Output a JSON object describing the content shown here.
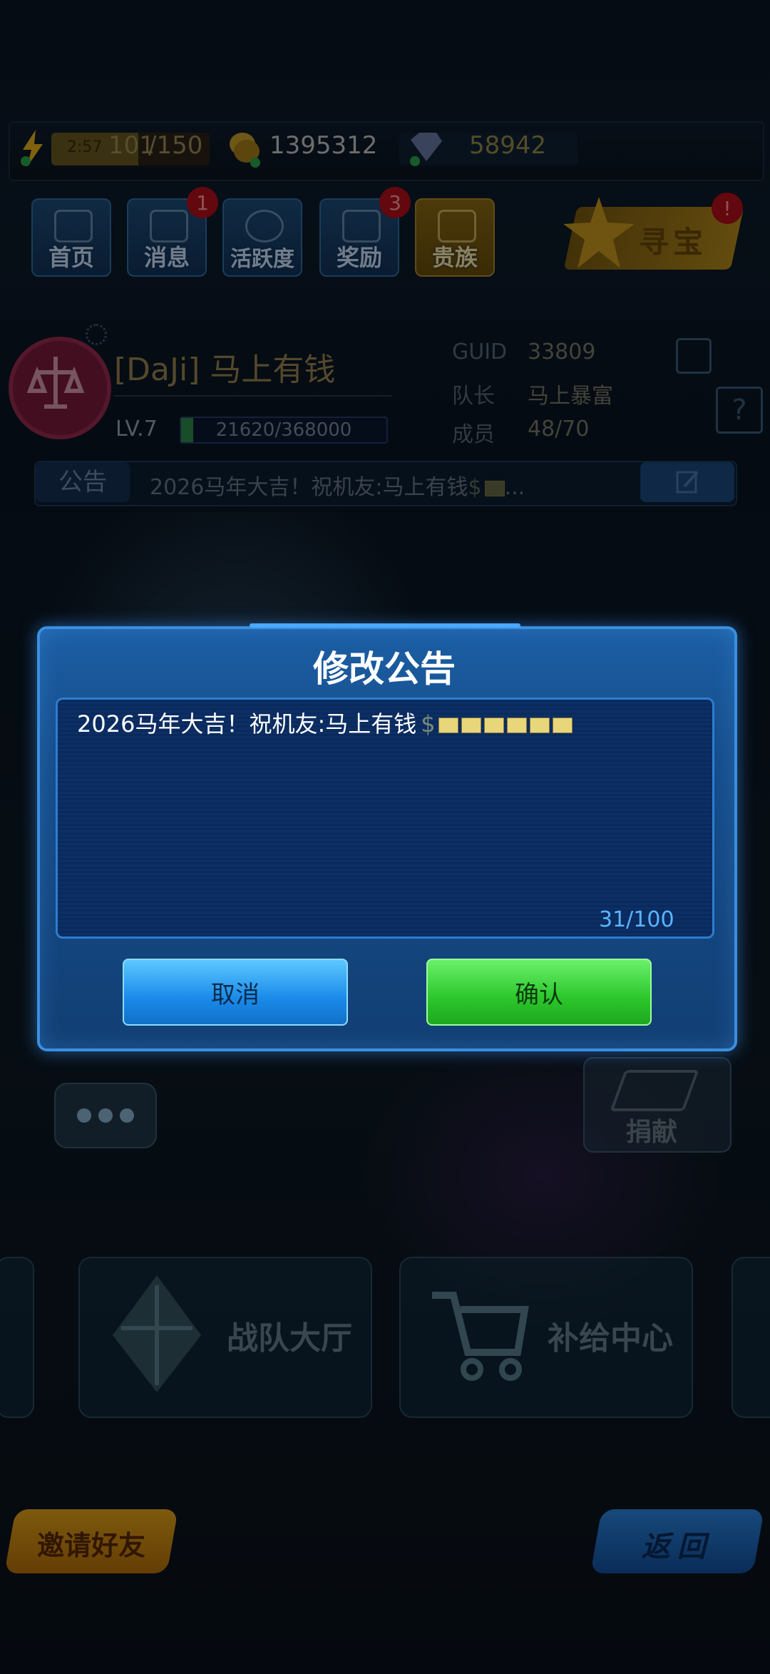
{
  "status_bar": {
    "energy_timer": "2:57",
    "energy_current": "101",
    "energy_max": "/150",
    "coins": "1395312",
    "gems": "58942",
    "icons": [
      "lightning-plus-icon",
      "coin-plus-icon",
      "diamond-plus-icon"
    ]
  },
  "nav": {
    "items": [
      {
        "label": "首页",
        "badge": ""
      },
      {
        "label": "消息",
        "badge": "1"
      },
      {
        "label": "活跃度",
        "badge": ""
      },
      {
        "label": "奖励",
        "badge": "3"
      },
      {
        "label": "贵族",
        "badge": ""
      }
    ],
    "treasure_label": "寻宝",
    "treasure_badge": "!"
  },
  "guild": {
    "name": "[DaJi] 马上有钱",
    "level": "LV.7",
    "xp_text": "21620/368000",
    "xp_fraction": 0.0587,
    "guid_label": "GUID",
    "guid_value": "33809",
    "leader_label": "队长",
    "leader_value": "马上暴富",
    "members_label": "成员",
    "members_value": "48/70",
    "notice_tag": "公告",
    "notice_text": "2026马年大吉！祝机友:马上有钱",
    "notice_ellipsis": "..."
  },
  "modal": {
    "title": "修改公告",
    "content": "2026马年大吉！祝机友:马上有钱",
    "dollar": "$",
    "counter": "31/100",
    "cancel_label": "取消",
    "confirm_label": "确认",
    "accent": "#3a8fe0"
  },
  "lower": {
    "donate_label": "捐献",
    "hall_label": "战队大厅",
    "supply_label": "补给中心",
    "invite_label": "邀请好友",
    "back_label": "返回"
  }
}
